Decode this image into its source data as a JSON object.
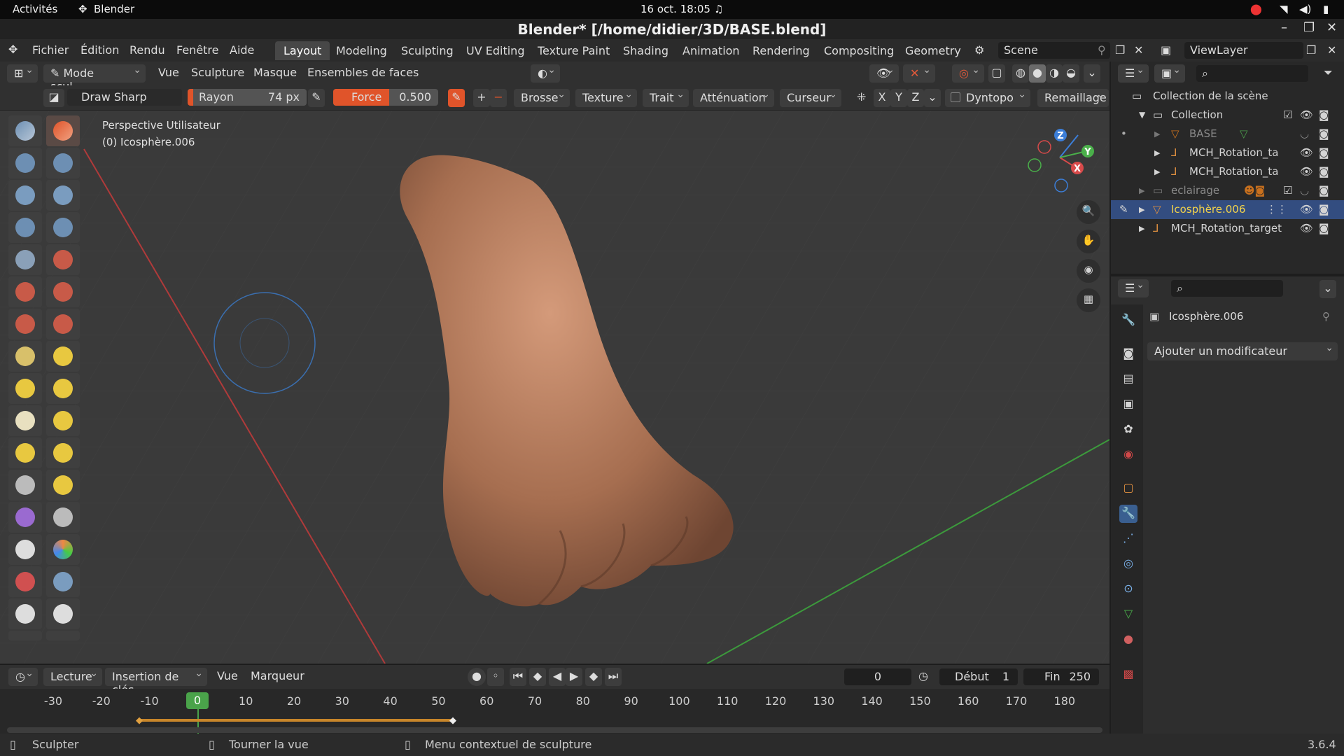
{
  "gnome": {
    "activities": "Activités",
    "app": "Blender",
    "datetime": "16 oct. 18:05"
  },
  "window": {
    "title": "Blender* [/home/didier/3D/BASE.blend]"
  },
  "menubar": {
    "items": [
      "Fichier",
      "Édition",
      "Rendu",
      "Fenêtre",
      "Aide"
    ],
    "tabs": [
      "Layout",
      "Modeling",
      "Sculpting",
      "UV Editing",
      "Texture Paint",
      "Shading",
      "Animation",
      "Rendering",
      "Compositing",
      "Geometry N"
    ],
    "active_tab": "Layout",
    "scene": "Scene",
    "viewlayer": "ViewLayer"
  },
  "header1": {
    "mode": "Mode scul...",
    "menus": [
      "Vue",
      "Sculpture",
      "Masque",
      "Ensembles de faces"
    ]
  },
  "header2": {
    "brush_name": "Draw Sharp",
    "radius_label": "Rayon",
    "radius_value": "74 px",
    "strength_label": "Force",
    "strength_value": "0.500",
    "plus": "+",
    "minus": "−",
    "dropdowns": [
      "Brosse",
      "Texture",
      "Trait",
      "Atténuation",
      "Curseur"
    ],
    "axes": [
      "X",
      "Y",
      "Z"
    ],
    "dyntopo": "Dyntopo",
    "remesh": "Remaillage"
  },
  "viewport": {
    "view_name": "Perspective Utilisateur",
    "object_name": "(0) Icosphère.006",
    "gizmo_axes": {
      "x": "X",
      "y": "Y",
      "z": "Z"
    },
    "colors": {
      "bg": "#3a3a3a",
      "x_axis": "#c33a3a",
      "y_axis": "#3c9a3c",
      "mesh": "#b07c5e"
    }
  },
  "outliner": {
    "root": "Collection de la scène",
    "rows": [
      {
        "label": "Collection",
        "level": 1,
        "color": "#dddddd"
      },
      {
        "label": "BASE",
        "level": 2,
        "color": "#8a8a8a"
      },
      {
        "label": "MCH_Rotation_ta",
        "level": 2,
        "color": "#dddddd"
      },
      {
        "label": "MCH_Rotation_ta",
        "level": 2,
        "color": "#dddddd"
      },
      {
        "label": "eclairage",
        "level": 1,
        "color": "#8a8a8a"
      },
      {
        "label": "Icosphère.006",
        "level": 1,
        "color": "#f2d24a"
      },
      {
        "label": "MCH_Rotation_target",
        "level": 1,
        "color": "#dddddd"
      }
    ]
  },
  "properties": {
    "object": "Icosphère.006",
    "add_modifier": "Ajouter un modificateur"
  },
  "timeline_header": {
    "playback": "Lecture",
    "keying": "Insertion de clés",
    "view": "Vue",
    "marker": "Marqueur",
    "current_frame": "0",
    "start_label": "Début",
    "start": "1",
    "end_label": "Fin",
    "end": "250"
  },
  "timeline": {
    "ticks": [
      "-30",
      "-20",
      "-10",
      "0",
      "10",
      "20",
      "30",
      "40",
      "50",
      "60",
      "70",
      "80",
      "90",
      "100",
      "110",
      "120",
      "130",
      "140",
      "150",
      "160",
      "170",
      "180"
    ],
    "current": "0"
  },
  "status": {
    "left": "Sculpter",
    "middle": "Tourner la vue",
    "right": "Menu contextuel de sculpture",
    "version": "3.6.4"
  }
}
